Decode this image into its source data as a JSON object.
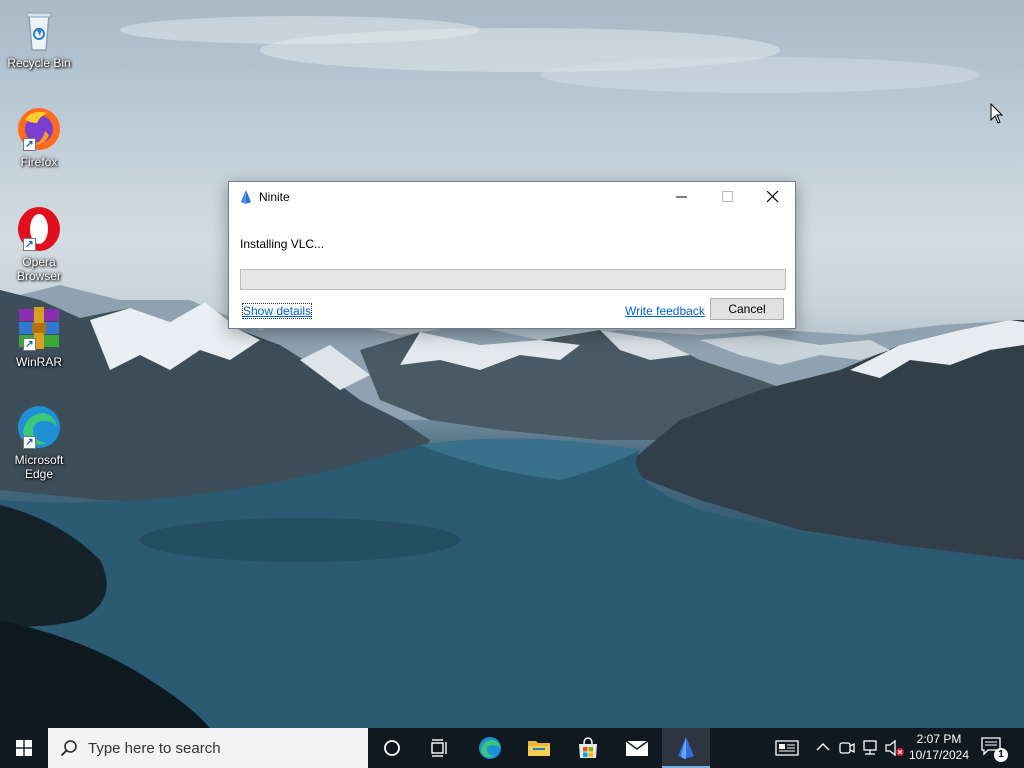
{
  "desktop": {
    "icons": [
      {
        "label": "Recycle Bin",
        "icon": "recycle-bin-icon"
      },
      {
        "label": "Firefox",
        "icon": "firefox-icon"
      },
      {
        "label": "Opera Browser",
        "icon": "opera-icon"
      },
      {
        "label": "WinRAR",
        "icon": "winrar-icon"
      },
      {
        "label": "Microsoft Edge",
        "icon": "edge-icon"
      }
    ]
  },
  "window": {
    "title": "Ninite",
    "icon": "ninite-icon",
    "status": "Installing VLC...",
    "progress": 0,
    "show_details": "Show details",
    "write_feedback": "Write feedback",
    "cancel": "Cancel"
  },
  "taskbar": {
    "search_placeholder": "Type here to search",
    "apps": [
      "cortana-icon",
      "task-view-icon",
      "edge-icon",
      "file-explorer-icon",
      "store-icon",
      "mail-icon",
      "ninite-icon"
    ],
    "clock": {
      "time": "2:07 PM",
      "date": "10/17/2024"
    },
    "notification_count": "1"
  },
  "colors": {
    "taskbar": "#101820",
    "link": "#0066cc",
    "progress_track": "#e6e6e6"
  }
}
